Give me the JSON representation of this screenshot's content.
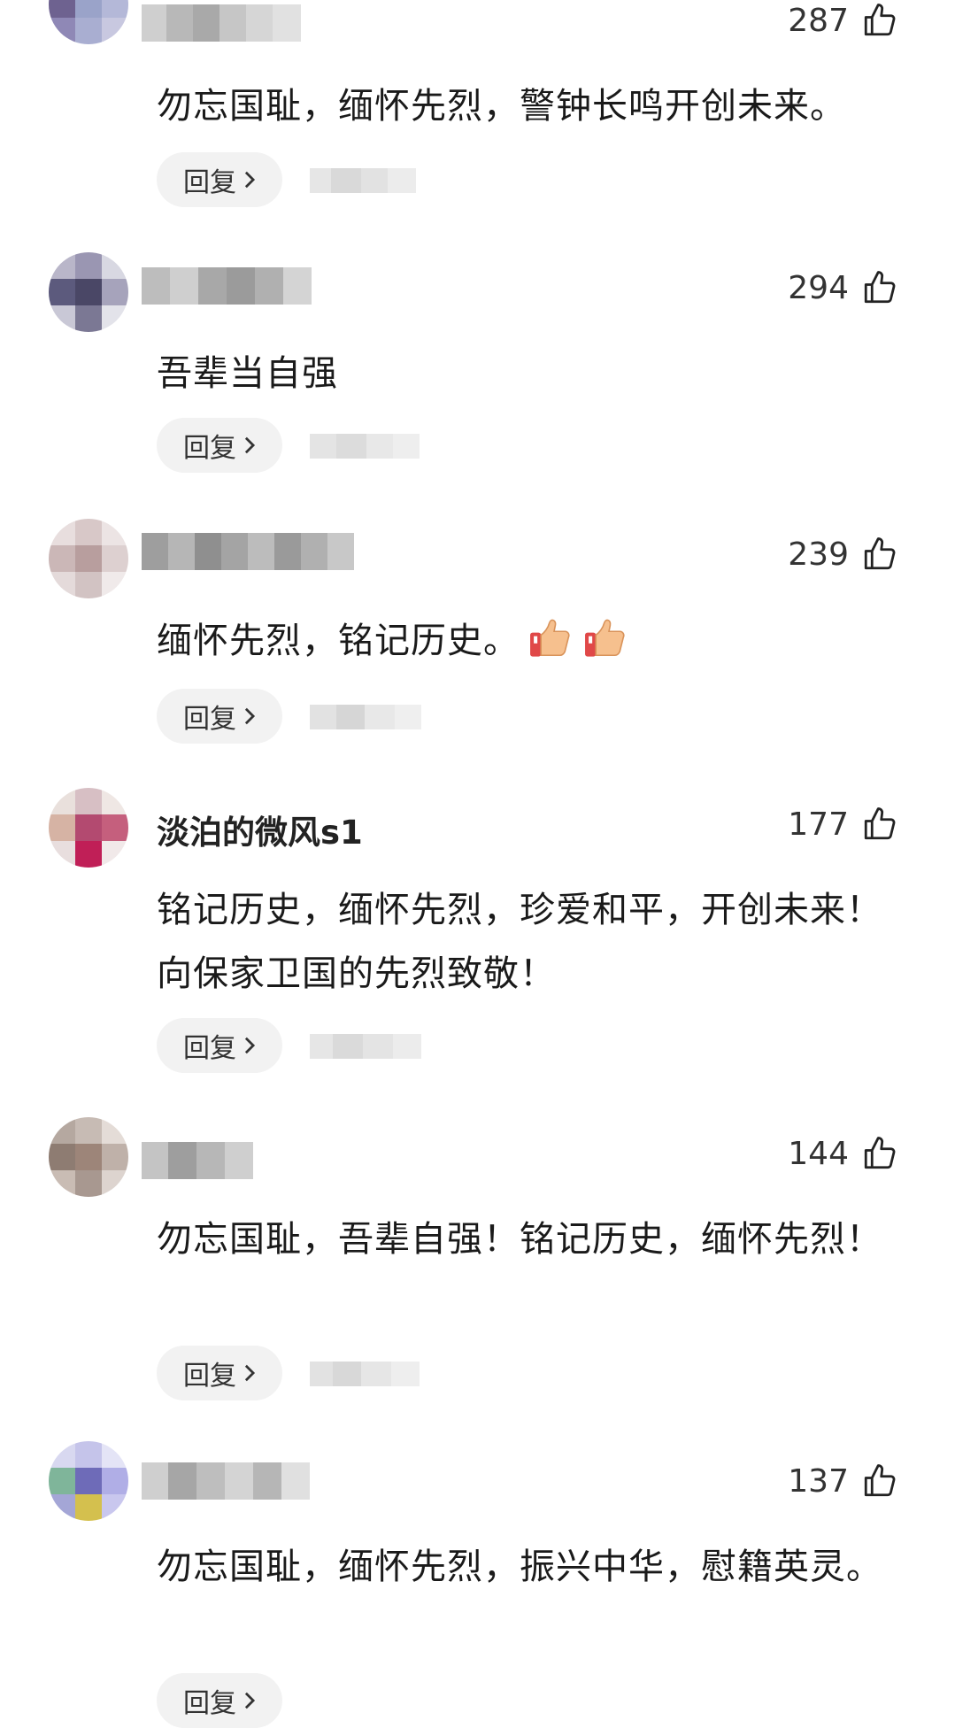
{
  "comments": [
    {
      "username": "",
      "likes": "287",
      "text": "勿忘国耻，缅怀先烈，警钟长鸣开创未来。",
      "reply_label": "回复"
    },
    {
      "username": "",
      "likes": "294",
      "text": "吾辈当自强",
      "reply_label": "回复"
    },
    {
      "username": "",
      "likes": "239",
      "text": "缅怀先烈，铭记历史。",
      "reply_label": "回复"
    },
    {
      "username": "淡泊的微风s1",
      "likes": "177",
      "text": "铭记历史，缅怀先烈，珍爱和平，开创未来！向保家卫国的先烈致敬！",
      "reply_label": "回复"
    },
    {
      "username": "",
      "likes": "144",
      "text": "勿忘国耻，吾辈自强！铭记历史，缅怀先烈！",
      "reply_label": "回复"
    },
    {
      "username": "",
      "likes": "137",
      "text": "勿忘国耻，缅怀先烈，振兴中华，慰籍英灵。",
      "reply_label": "回复"
    }
  ],
  "icons": {
    "like": "thumbs-up-outline-icon",
    "chevron": "chevron-right-icon",
    "emoji": "thumbs-up-emoji"
  },
  "colors": {
    "reply_bg": "#f2f2f2",
    "text": "#1a1a1a"
  }
}
